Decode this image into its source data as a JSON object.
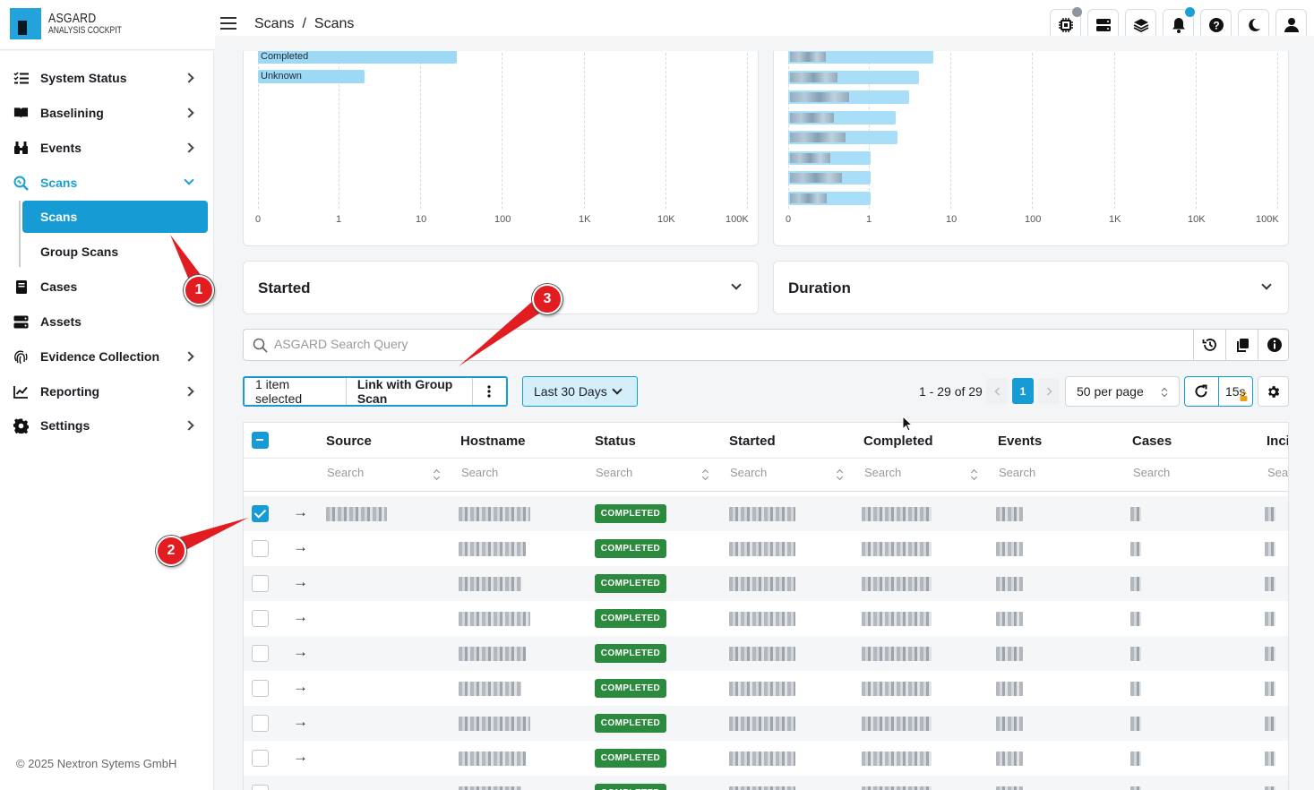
{
  "app": {
    "name": "ASGARD",
    "subtitle": "ANALYSIS COCKPIT"
  },
  "breadcrumb": [
    "Scans",
    "/",
    "Scans"
  ],
  "sidebar": {
    "items": [
      {
        "label": "System Status",
        "icon": "checklist-icon"
      },
      {
        "label": "Baselining",
        "icon": "book-icon"
      },
      {
        "label": "Events",
        "icon": "binoculars-icon"
      },
      {
        "label": "Scans",
        "icon": "scan-search-icon"
      },
      {
        "label": "Cases",
        "icon": "notebook-icon"
      },
      {
        "label": "Assets",
        "icon": "server-icon"
      },
      {
        "label": "Evidence Collection",
        "icon": "fingerprint-icon"
      },
      {
        "label": "Reporting",
        "icon": "line-chart-icon"
      },
      {
        "label": "Settings",
        "icon": "gear-icon"
      }
    ],
    "sub_items": [
      {
        "label": "Scans",
        "active": true
      },
      {
        "label": "Group Scans",
        "active": false
      }
    ],
    "footer": "© 2025 Nextron Sytems GmbH"
  },
  "chart_left": {
    "ticks": [
      "0",
      "1",
      "10",
      "100",
      "1K",
      "10K",
      "100K"
    ],
    "bars": [
      {
        "label": "Completed"
      },
      {
        "label": "Unknown"
      }
    ]
  },
  "chart_right": {
    "ticks": [
      "0",
      "1",
      "10",
      "100",
      "1K",
      "10K",
      "100K"
    ]
  },
  "panels": {
    "started": "Started",
    "duration": "Duration"
  },
  "search": {
    "placeholder": "ASGARD Search Query"
  },
  "toolbar": {
    "selected": "1 item selected",
    "link_group": "Link with Group Scan",
    "range": "Last 30 Days",
    "pager_text": "1 - 29 of 29",
    "page": "1",
    "per_page": "50 per page",
    "refresh_interval": "15s"
  },
  "table": {
    "columns": [
      "Source",
      "Hostname",
      "Status",
      "Started",
      "Completed",
      "Events",
      "Cases",
      "Inci"
    ],
    "filter_placeholder": "Search",
    "status_value": "COMPLETED",
    "rows": 9
  },
  "annotations": [
    "1",
    "2",
    "3"
  ],
  "colors": {
    "accent": "#169bd5",
    "status_completed": "#2c8a3e",
    "callout": "#e11d22"
  }
}
